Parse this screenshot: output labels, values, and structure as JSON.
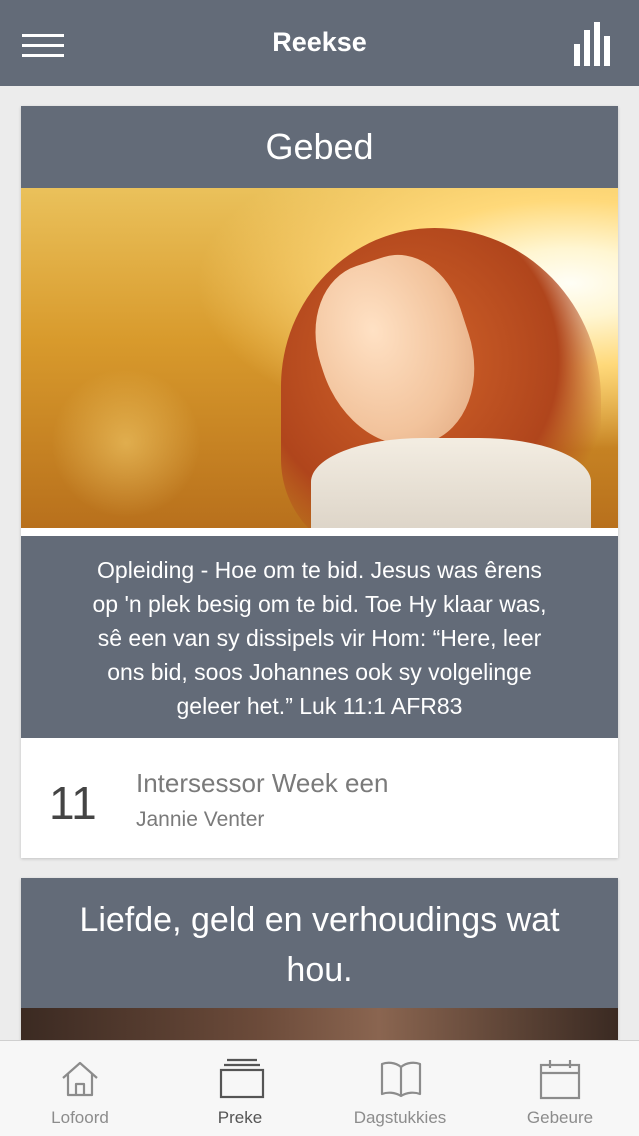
{
  "header": {
    "title": "Reekse",
    "menu_icon": "hamburger-menu-icon",
    "stats_icon": "bar-chart-icon"
  },
  "cards": [
    {
      "title": "Gebed",
      "image": "woman-in-sunlight-photo",
      "description_lines": [
        "Opleiding - Hoe om te bid. Jesus was êrens",
        "op 'n plek besig om te bid. Toe Hy klaar was,",
        "sê een van sy dissipels vir Hom: “Here, leer",
        "ons bid, soos Johannes ook sy volgelinge",
        "geleer het.” Luk 11:1 AFR83"
      ],
      "item": {
        "number": "11",
        "title": "Intersessor Week een",
        "author": "Jannie Venter"
      }
    },
    {
      "title_lines": [
        "Liefde, geld en verhoudings wat",
        "hou."
      ]
    }
  ],
  "tabs": [
    {
      "label": "Lofoord",
      "icon": "home-icon"
    },
    {
      "label": "Preke",
      "icon": "stack-icon"
    },
    {
      "label": "Dagstukkies",
      "icon": "book-icon"
    },
    {
      "label": "Gebeure",
      "icon": "calendar-icon"
    }
  ],
  "colors": {
    "header_bg": "#636b78",
    "tab_active": "#555555",
    "tab_inactive": "#8c8c8c"
  }
}
